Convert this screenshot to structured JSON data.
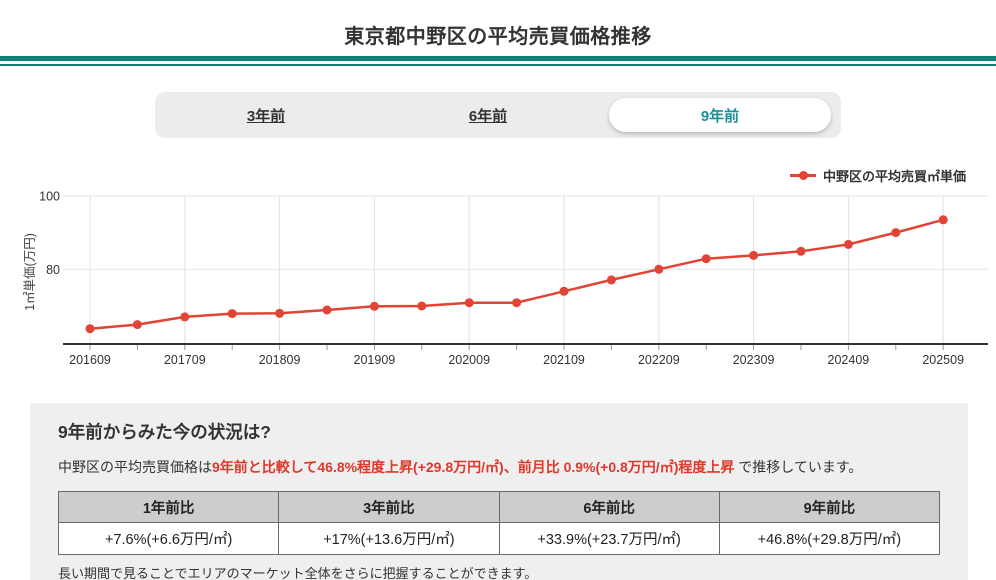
{
  "header": {
    "title": "東京都中野区の平均売買価格推移"
  },
  "tabs": [
    {
      "label": "3年前",
      "active": false
    },
    {
      "label": "6年前",
      "active": false
    },
    {
      "label": "9年前",
      "active": true
    }
  ],
  "legend": {
    "label": "中野区の平均売買㎡単価"
  },
  "chart_data": {
    "type": "line",
    "title": "",
    "xlabel": "",
    "ylabel": "1㎡単価(万円)",
    "x": [
      "201609",
      "201703",
      "201709",
      "201803",
      "201809",
      "201903",
      "201909",
      "202003",
      "202009",
      "202103",
      "202109",
      "202203",
      "202209",
      "202303",
      "202309",
      "202403",
      "202409",
      "202503",
      "202509"
    ],
    "x_tick_labels": [
      "201609",
      "201709",
      "201809",
      "201909",
      "202009",
      "202109",
      "202209",
      "202309",
      "202409",
      "202509"
    ],
    "series": [
      {
        "name": "中野区の平均売買㎡単価",
        "values": [
          63.8,
          64.9,
          67.0,
          67.9,
          68.0,
          68.9,
          69.9,
          70.0,
          70.9,
          70.9,
          74.0,
          77.1,
          80.0,
          82.9,
          83.8,
          84.9,
          86.8,
          90.0,
          93.5
        ]
      }
    ],
    "ylim": [
      60,
      102
    ],
    "yticks": [
      80,
      100
    ],
    "grid": true,
    "legend_position": "top-right",
    "line_color": "#e14334",
    "grid_color": "#e2e2e2",
    "axis_color": "#333333"
  },
  "summary": {
    "heading": "9年前からみた今の状況は?",
    "paragraph_prefix": "中野区の平均売買価格は",
    "paragraph_highlight": "9年前と比較して46.8%程度上昇(+29.8万円/㎡)、前月比 0.9%(+0.8万円/㎡)程度上昇",
    "paragraph_suffix": " で推移しています。",
    "table": {
      "headers": [
        "1年前比",
        "3年前比",
        "6年前比",
        "9年前比"
      ],
      "values": [
        "+7.6%(+6.6万円/㎡)",
        "+17%(+13.6万円/㎡)",
        "+33.9%(+23.7万円/㎡)",
        "+46.8%(+29.8万円/㎡)"
      ]
    },
    "note": "長い期間で見ることでエリアのマーケット全体をさらに把握することができます。"
  },
  "colors": {
    "accent_teal": "#0e7d73",
    "tab_active_text": "#17919b",
    "line_red": "#e14334",
    "highlight_red": "#e0382b",
    "section_bg": "#efefef",
    "table_header_bg": "#cdcdcd"
  }
}
